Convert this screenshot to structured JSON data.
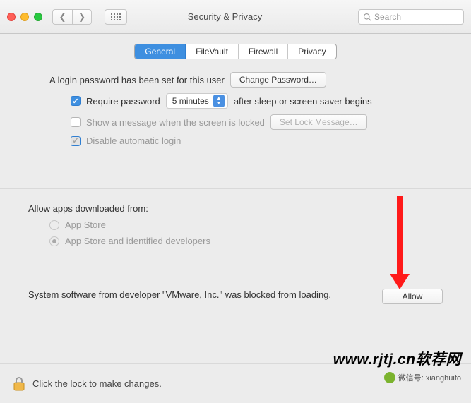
{
  "titlebar": {
    "title": "Security & Privacy",
    "search_placeholder": "Search"
  },
  "tabs": {
    "items": [
      "General",
      "FileVault",
      "Firewall",
      "Privacy"
    ],
    "active_index": 0
  },
  "general": {
    "login_pw_text": "A login password has been set for this user",
    "change_pw_btn": "Change Password…",
    "require_pw_label": "Require password",
    "require_pw_delay": "5 minutes",
    "after_sleep_label": "after sleep or screen saver begins",
    "show_message_label": "Show a message when the screen is locked",
    "set_lock_msg_btn": "Set Lock Message…",
    "disable_auto_login_label": "Disable automatic login",
    "allow_apps_heading": "Allow apps downloaded from:",
    "radio_appstore": "App Store",
    "radio_identified": "App Store and identified developers",
    "blocked_text": "System software from developer \"VMware, Inc.\" was blocked from loading.",
    "allow_btn": "Allow"
  },
  "footer": {
    "lock_text": "Click the lock to make changes."
  },
  "watermark": {
    "main": "www.rjtj.cn软荐网",
    "sub": "微信号: xianghuifo"
  }
}
